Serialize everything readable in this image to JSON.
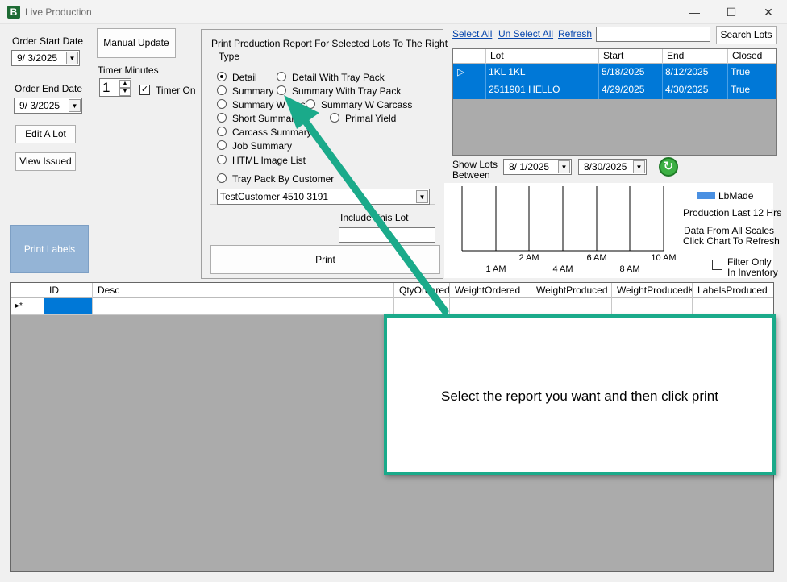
{
  "window": {
    "title": "Live Production",
    "controls": {
      "minimize": "—",
      "maximize": "☐",
      "close": "✕"
    }
  },
  "left": {
    "order_start_label": "Order Start Date",
    "order_start_value": "9/  3/2025",
    "order_end_label": "Order End Date",
    "order_end_value": "9/  3/2025",
    "manual_update": "Manual Update",
    "timer_minutes_label": "Timer Minutes",
    "timer_minutes_value": "1",
    "timer_on_label": "Timer On",
    "edit_lot": "Edit A Lot",
    "view_issued": "View Issued",
    "print_labels": "Print Labels"
  },
  "print_panel": {
    "title": "Print Production Report For Selected Lots To The Right",
    "type_label": "Type",
    "options": {
      "detail": "Detail",
      "detail_tray": "Detail With Tray Pack",
      "summary": "Summary",
      "summary_tray": "Summary With Tray Pack",
      "summary_wcost": "Summary  W Cost",
      "summary_wcarcass": "Summary  W Carcass",
      "short_summary": "Short Summary",
      "primal_yield": "Primal Yield",
      "carcass_summary": "Carcass Summary",
      "job_summary": "Job Summary",
      "html_image_list": "HTML Image List",
      "tray_pack_customer": "Tray Pack By Customer"
    },
    "customer_value": "TestCustomer 4510 3191",
    "include_lot_label": "Include This Lot",
    "include_lot_value": "",
    "print_button": "Print"
  },
  "lots": {
    "select_all": "Select All",
    "unselect_all": "Un Select All",
    "refresh": "Refresh",
    "search_value": "",
    "search_button": "Search Lots",
    "columns": [
      "Lot",
      "Start",
      "End",
      "Closed"
    ],
    "rows": [
      {
        "lot": "1KL 1KL",
        "start": "5/18/2025",
        "end": "8/12/2025",
        "closed": "True"
      },
      {
        "lot": "2511901 HELLO",
        "start": "4/29/2025",
        "end": "4/30/2025",
        "closed": "True"
      }
    ],
    "row_indicator": "▷",
    "show_lots_label": "Show Lots",
    "between_label": "Between",
    "between_from": "8/  1/2025",
    "between_to": "8/30/2025"
  },
  "chart": {
    "legend_label": "LbMade",
    "legend_color": "#4a90e2",
    "production_label": "Production Last 12 Hrs",
    "data_from_label": "Data From All Scales",
    "click_refresh_label": "Click Chart To Refresh",
    "ticks_top": [
      "2 AM",
      "6 AM",
      "10 AM"
    ],
    "ticks_bottom": [
      "1 AM",
      "4 AM",
      "8 AM"
    ],
    "filter_only_label": "Filter Only",
    "in_inventory_label": "In Inventory"
  },
  "main_grid": {
    "columns": [
      "",
      "ID",
      "Desc",
      "QtyOrdered",
      "WeightOrdered",
      "WeightProduced",
      "WeightProducedKg",
      "LabelsProduced"
    ],
    "new_row_indicator": "▸*"
  },
  "callout": {
    "text": "Select the report you want and then click print"
  }
}
